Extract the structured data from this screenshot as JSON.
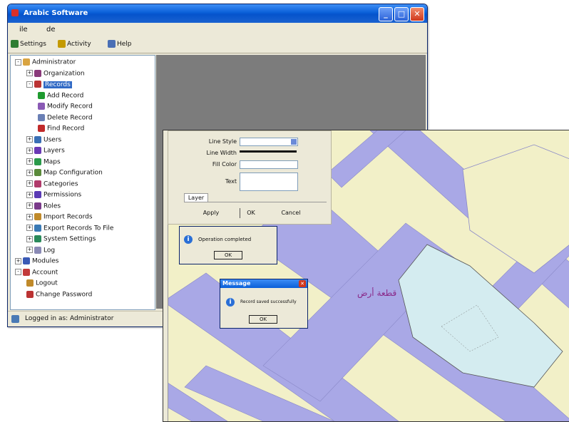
{
  "main_window": {
    "title": "Arabic Software",
    "controls": {
      "minimize": "_",
      "maximize": "□",
      "close": "✕"
    }
  },
  "menu": [
    "ile",
    "de"
  ],
  "toolbar": [
    {
      "label": "Settings",
      "icon": "globe-icon",
      "color": "#2e7d32"
    },
    {
      "label": "Activity",
      "icon": "pencil-icon",
      "color": "#c49a00"
    },
    {
      "label": "Help",
      "icon": "help-icon",
      "color": "#4a6fb5"
    }
  ],
  "tree": [
    {
      "label": "Administrator",
      "level": 0,
      "expander": "-",
      "icon": "home-icon",
      "color": "#d9a441"
    },
    {
      "label": "Organization",
      "level": 1,
      "expander": "+",
      "icon": "org-icon",
      "color": "#8a3a7a"
    },
    {
      "label": "Records",
      "level": 1,
      "expander": "-",
      "icon": "records-icon",
      "color": "#b33",
      "selected": true
    },
    {
      "label": "Add Record",
      "level": 2,
      "expander": "",
      "icon": "add-icon",
      "color": "#1f9a2f"
    },
    {
      "label": "Modify Record",
      "level": 2,
      "expander": "",
      "icon": "check-icon",
      "color": "#8a5ab5"
    },
    {
      "label": "Delete Record",
      "level": 2,
      "expander": "",
      "icon": "delete-icon",
      "color": "#6a7fb5"
    },
    {
      "label": "Find Record",
      "level": 2,
      "expander": "",
      "icon": "find-icon",
      "color": "#c12a2a"
    },
    {
      "label": "Users",
      "level": 1,
      "expander": "+",
      "icon": "users-icon",
      "color": "#3a6fb5"
    },
    {
      "label": "Layers",
      "level": 1,
      "expander": "+",
      "icon": "layers-icon",
      "color": "#6a3ab5"
    },
    {
      "label": "Maps",
      "level": 1,
      "expander": "+",
      "icon": "map-icon",
      "color": "#2a9a4a"
    },
    {
      "label": "Map Configuration",
      "level": 1,
      "expander": "+",
      "icon": "config-icon",
      "color": "#5a8a3a"
    },
    {
      "label": "Categories",
      "level": 1,
      "expander": "+",
      "icon": "category-icon",
      "color": "#b03a6a"
    },
    {
      "label": "Permissions",
      "level": 1,
      "expander": "+",
      "icon": "permission-icon",
      "color": "#5a3ab5"
    },
    {
      "label": "Roles",
      "level": 1,
      "expander": "+",
      "icon": "roles-icon",
      "color": "#7a3a8a"
    },
    {
      "label": "Import Records",
      "level": 1,
      "expander": "+",
      "icon": "import-icon",
      "color": "#c08a2a"
    },
    {
      "label": "Export Records To File",
      "level": 1,
      "expander": "+",
      "icon": "export-icon",
      "color": "#3a7ab5"
    },
    {
      "label": "System Settings",
      "level": 1,
      "expander": "+",
      "icon": "settings-icon",
      "color": "#2a8a5a"
    },
    {
      "label": "Log",
      "level": 1,
      "expander": "+",
      "icon": "log-icon",
      "color": "#8a8ab5"
    },
    {
      "label": "Modules",
      "level": 0,
      "expander": "+",
      "icon": "modules-icon",
      "color": "#3a5ab5"
    },
    {
      "label": "Account",
      "level": 0,
      "expander": "-",
      "icon": "account-icon",
      "color": "#c23a3a"
    },
    {
      "label": "Logout",
      "level": 1,
      "expander": "",
      "icon": "logout-icon",
      "color": "#c08a2a"
    },
    {
      "label": "Change Password",
      "level": 1,
      "expander": "",
      "icon": "password-icon",
      "color": "#b33"
    }
  ],
  "status": {
    "text": "Logged in as: Administrator",
    "icon": "status-icon"
  },
  "properties": {
    "rows": [
      {
        "label": "Line Style",
        "type": "select"
      },
      {
        "label": "Line Width",
        "type": "line"
      },
      {
        "label": "Fill Color",
        "type": "input"
      },
      {
        "label": "Text",
        "type": "textarea"
      }
    ],
    "tab": "Layer",
    "buttons": [
      "Apply",
      "OK",
      "Cancel"
    ]
  },
  "dialog_small": {
    "message": "Operation completed",
    "ok": "OK"
  },
  "dialog_main": {
    "title": "Message",
    "message": "Record saved successfully",
    "ok": "OK"
  },
  "map": {
    "label": "قطعة أرض",
    "colors": {
      "background": "#f2f0c8",
      "road": "#a9a8e6",
      "parcel": "#d4ecf0",
      "label": "#8a2a8a"
    }
  }
}
